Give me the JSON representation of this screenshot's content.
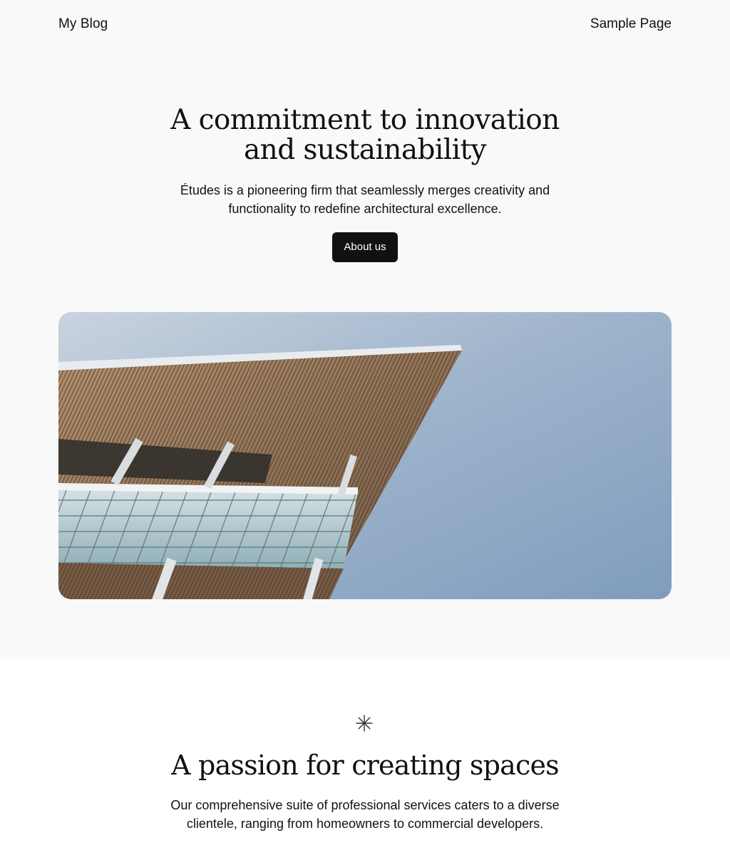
{
  "header": {
    "site_title": "My Blog",
    "nav": [
      {
        "label": "Sample Page"
      }
    ]
  },
  "hero": {
    "heading": "A commitment to innovation and sustainability",
    "description": "Études is a pioneering firm that seamlessly merges creativity and functionality to redefine architectural excellence.",
    "button_label": "About us"
  },
  "section": {
    "heading": "A passion for creating spaces",
    "description": "Our comprehensive suite of professional services caters to a diverse clientele, ranging from homeowners to commercial developers."
  },
  "colors": {
    "page_background": "#f9f9f9",
    "section_background": "#ffffff",
    "button_background": "#111111",
    "text": "#111111"
  },
  "icons": {
    "section_icon": "asterisk-icon"
  }
}
